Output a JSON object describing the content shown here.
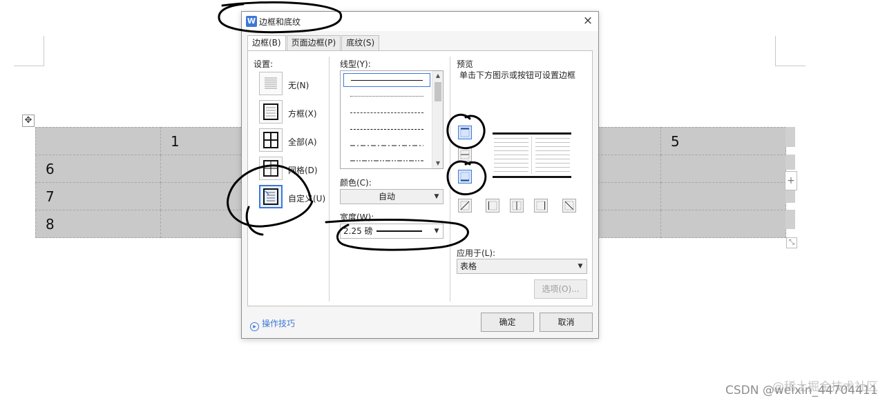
{
  "document": {
    "table_rows": [
      [
        "",
        "1",
        "",
        "",
        "",
        "5"
      ],
      [
        "6",
        "",
        "",
        "",
        "",
        ""
      ],
      [
        "7",
        "",
        "",
        "",
        "",
        ""
      ],
      [
        "8",
        "",
        "",
        "",
        "",
        ""
      ]
    ],
    "move_handle_icon": "move-cross-icon",
    "add_column_icon": "plus-icon",
    "resize_icon": "resize-diagonal-icon"
  },
  "watermark": "CSDN @weixin_44704411",
  "watermark2": "@稀土掘金技术社区",
  "dialog": {
    "title": "边框和底纹",
    "app_icon_letter": "W",
    "close_label": "×",
    "tabs": [
      {
        "label": "边框(B)",
        "active": true
      },
      {
        "label": "页面边框(P)",
        "active": false
      },
      {
        "label": "底纹(S)",
        "active": false
      }
    ],
    "settings": {
      "title": "设置:",
      "items": [
        {
          "label": "无(N)",
          "icon": "no-border-icon"
        },
        {
          "label": "方框(X)",
          "icon": "box-border-icon"
        },
        {
          "label": "全部(A)",
          "icon": "all-borders-icon"
        },
        {
          "label": "网格(D)",
          "icon": "grid-border-icon"
        },
        {
          "label": "自定义(U)",
          "icon": "custom-border-icon",
          "selected": true
        }
      ]
    },
    "line_style": {
      "title": "线型(Y):",
      "styles": [
        "solid",
        "dotted-fine",
        "dashed-small",
        "dashed",
        "dash-dot",
        "dash-dot-dot"
      ],
      "selected_index": 0
    },
    "color": {
      "title": "颜色(C):",
      "value": "自动"
    },
    "width": {
      "title": "宽度(W):",
      "value": "2.25 磅"
    },
    "preview": {
      "title": "预览",
      "hint": "单击下方图示或按钮可设置边框"
    },
    "apply_to": {
      "title": "应用于(L):",
      "value": "表格"
    },
    "options_button": "选项(O)...",
    "tips_link": "操作技巧",
    "ok_button": "确定",
    "cancel_button": "取消",
    "colors": {
      "accent": "#3c78d8",
      "table_fill": "#c9c9c9",
      "annotation_ink": "#000000"
    }
  }
}
